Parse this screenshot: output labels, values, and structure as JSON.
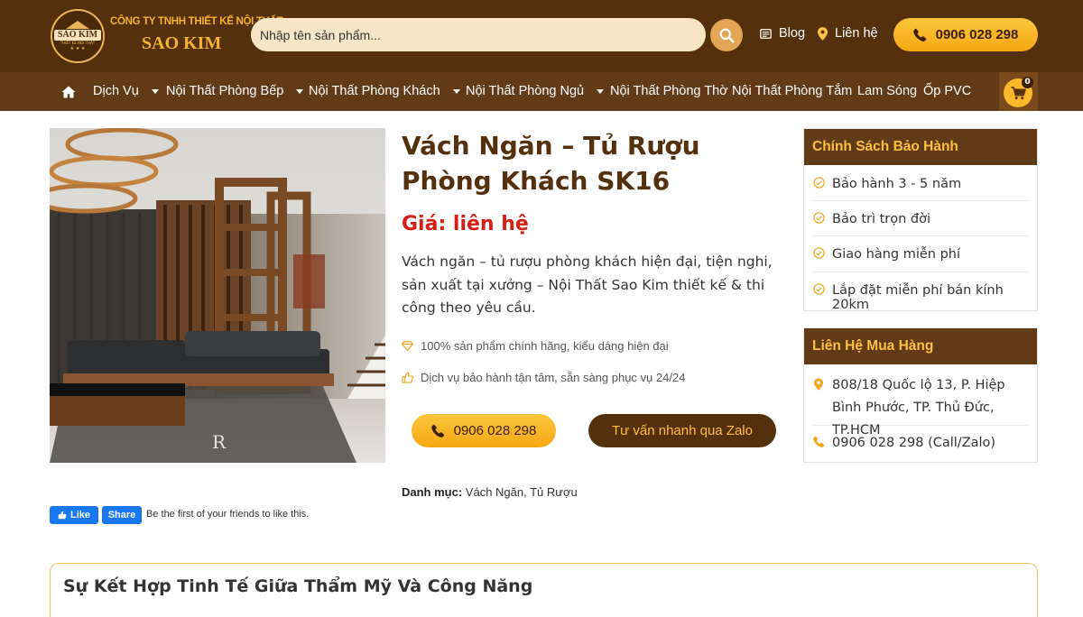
{
  "header": {
    "logo": {
      "word": "SAO KIM",
      "tagline": "THIẾT KẾ NỘI THẤT"
    },
    "company_line1": "CÔNG TY TNHH THIẾT KẾ NỘI THẤT",
    "company_line2": "SAO KIM",
    "search_placeholder": "Nhập tên sản phẩm...",
    "blog_label": "Blog",
    "contact_label": "Liên hệ",
    "hotline": "0906 028 298"
  },
  "nav": {
    "items": [
      {
        "label": "Dịch Vụ",
        "has_dropdown": true
      },
      {
        "label": "Nội Thất Phòng Bếp",
        "has_dropdown": true
      },
      {
        "label": "Nội Thất Phòng Khách",
        "has_dropdown": true
      },
      {
        "label": "Nội Thất Phòng Ngủ",
        "has_dropdown": true
      },
      {
        "label": "Nội Thất Phòng Thờ",
        "has_dropdown": false
      },
      {
        "label": "Nội Thất Phòng Tắm",
        "has_dropdown": false
      },
      {
        "label": "Lam Sóng",
        "has_dropdown": false
      },
      {
        "label": "Ốp PVC",
        "has_dropdown": false
      }
    ],
    "cart_count": "0"
  },
  "product": {
    "image_watermark": "R",
    "title": "Vách Ngăn – Tủ Rượu Phòng Khách SK16",
    "price": "Giá: liên hệ",
    "description": "Vách ngăn – tủ rượu phòng khách hiện đại, tiện nghi, sản xuất tại xưởng – Nội Thất Sao Kim thiết kế & thi công theo yêu cầu.",
    "features": [
      {
        "icon": "diamond-icon",
        "text": "100% sản phẩm chính hãng, kiểu dáng hiện đại"
      },
      {
        "icon": "thumbs-up-icon",
        "text": "Dịch vụ bảo hành tận tâm, sẵn sàng phục vụ 24/24"
      }
    ],
    "call_button": "0906 028 298",
    "zalo_button": "Tư vấn nhanh qua Zalo",
    "category_label": "Danh mục:",
    "category_value": "Vách Ngăn, Tủ Rượu"
  },
  "facebook": {
    "like": "Like",
    "share": "Share",
    "text": "Be the first of your friends to like this."
  },
  "sidebar": {
    "warranty": {
      "title": "Chính Sách Bảo Hành",
      "items": [
        "Bảo hành 3 - 5 năm",
        "Bảo trì trọn đời",
        "Giao hàng miễn phí",
        "Lắp đặt miễn phí bán kính 20km"
      ]
    },
    "contact": {
      "title": "Liên Hệ Mua Hàng",
      "address": "808/18 Quốc lộ 13, P. Hiệp Bình Phước, TP. Thủ Đức, TP.HCM",
      "phone": "0906 028 298 (Call/Zalo)"
    }
  },
  "section": {
    "title": "Sự Kết Hợp Tinh Tế Giữa Thẩm Mỹ Và Công Năng"
  },
  "colors": {
    "brand_brown": "#55300c",
    "nav_brown": "#613a17",
    "accent_yellow": "#fdc040",
    "price_red": "#d61f12"
  }
}
